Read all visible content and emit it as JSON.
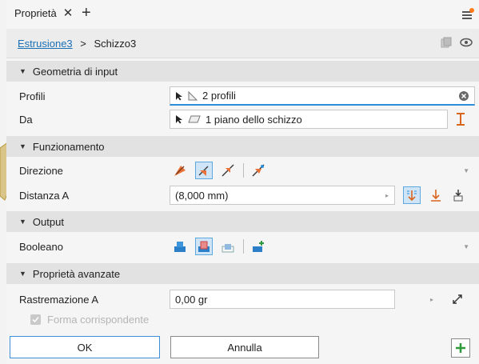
{
  "tab": {
    "title": "Proprietà"
  },
  "breadcrumb": {
    "parent": "Estrusione3",
    "separator": ">",
    "current": "Schizzo3"
  },
  "sections": {
    "input": {
      "title": "Geometria di input"
    },
    "behaviour": {
      "title": "Funzionamento"
    },
    "output": {
      "title": "Output"
    },
    "advanced": {
      "title": "Proprietà avanzate"
    }
  },
  "fields": {
    "profiles": {
      "label": "Profili",
      "value": "2 profili"
    },
    "plane": {
      "label": "Da",
      "value": "1 piano dello schizzo"
    },
    "direction": {
      "label": "Direzione"
    },
    "distance": {
      "label": "Distanza A",
      "value": "(8,000 mm)"
    },
    "boolean": {
      "label": "Booleano"
    },
    "taper": {
      "label": "Rastremazione A",
      "value": "0,00 gr"
    },
    "match_shape": {
      "label": "Forma corrispondente",
      "checked": true,
      "enabled": false
    }
  },
  "buttons": {
    "ok": "OK",
    "cancel": "Annulla"
  },
  "colors": {
    "accent": "#2b8dd8",
    "orange": "#e8733a",
    "link": "#1a6fb5",
    "add_green": "#2e9a3e"
  }
}
